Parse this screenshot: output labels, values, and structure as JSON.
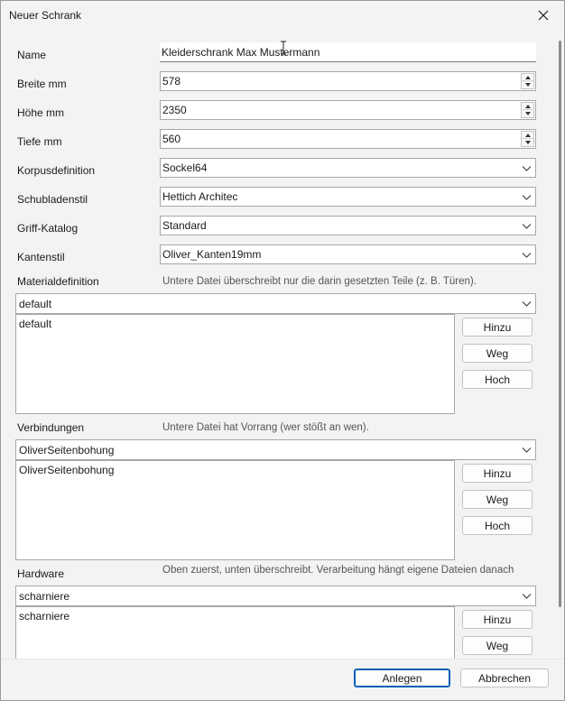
{
  "window": {
    "title": "Neuer Schrank"
  },
  "form": {
    "name": {
      "label": "Name",
      "value": "Kleiderschrank Max Mustermann"
    },
    "breite": {
      "label": "Breite mm",
      "value": "578"
    },
    "hoehe": {
      "label": "Höhe mm",
      "value": "2350"
    },
    "tiefe": {
      "label": "Tiefe mm",
      "value": "560"
    },
    "korpus": {
      "label": "Korpusdefinition",
      "value": "Sockel64"
    },
    "schublade": {
      "label": "Schubladenstil",
      "value": "Hettich Architec"
    },
    "griff": {
      "label": "Griff-Katalog",
      "value": "Standard"
    },
    "kanten": {
      "label": "Kantenstil",
      "value": "Oliver_Kanten19mm"
    }
  },
  "material": {
    "label": "Materialdefinition",
    "hint": "Untere Datei überschreibt nur die darin gesetzten Teile (z. B. Türen).",
    "selected": "default",
    "items": [
      "default"
    ]
  },
  "verbindungen": {
    "label": "Verbindungen",
    "hint": "Untere Datei hat Vorrang (wer stößt an wen).",
    "selected": "OliverSeitenbohung",
    "items": [
      "OliverSeitenbohung"
    ]
  },
  "hardware": {
    "label": "Hardware",
    "hint": "Oben zuerst, unten überschreibt. Verarbeitung hängt eigene Dateien danach",
    "selected": "scharniere",
    "items": [
      "scharniere"
    ]
  },
  "list_buttons": {
    "add": "Hinzu",
    "remove": "Weg",
    "up": "Hoch"
  },
  "footer": {
    "ok": "Anlegen",
    "cancel": "Abbrechen"
  },
  "colors": {
    "accent": "#005fb8",
    "background": "#f3f3f3",
    "field_border": "#a8a8a8"
  }
}
